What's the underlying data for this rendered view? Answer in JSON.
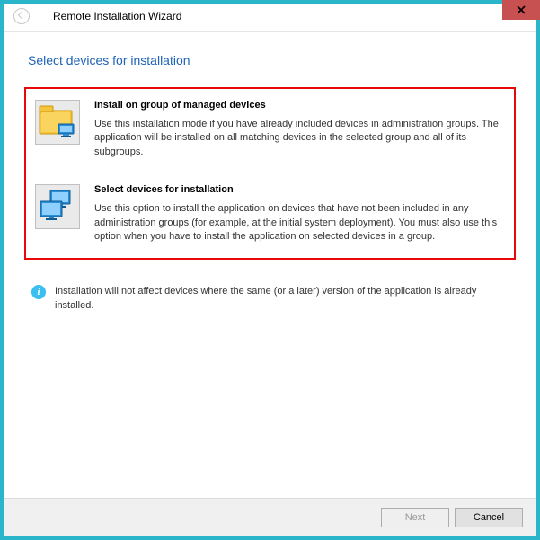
{
  "window": {
    "title": "Remote Installation Wizard"
  },
  "page": {
    "heading": "Select devices for installation"
  },
  "options": [
    {
      "title": "Install on group of managed devices",
      "desc": "Use this installation mode if you have already included devices in administration groups. The application will be installed on all matching devices in the selected group and all of its subgroups."
    },
    {
      "title": "Select devices for installation",
      "desc": "Use this option to install the application on devices that have not been included in any administration groups (for example, at the initial system deployment). You must also use this option when you have to install the application on selected devices in a group."
    }
  ],
  "info": {
    "text": "Installation will not affect devices where the same (or a later) version of the application is already installed."
  },
  "footer": {
    "next": "Next",
    "cancel": "Cancel"
  }
}
